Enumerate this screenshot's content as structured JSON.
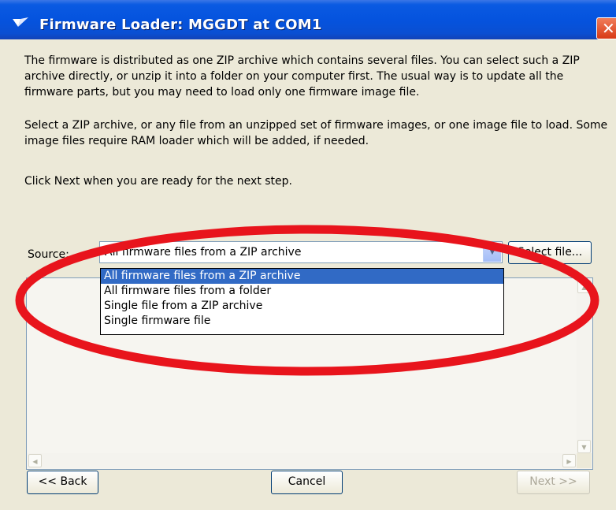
{
  "window": {
    "title": "Firmware Loader:  MGGDT at COM1",
    "close_glyph": "✕"
  },
  "body": {
    "paragraph1": "The firmware is distributed as one ZIP archive which contains several files. You can select such a ZIP archive directly, or unzip it into a folder on your computer first. The usual way is to update all the firmware parts, but you may need to load only one firmware image file.",
    "paragraph2": "Select a ZIP archive, or any file from an unzipped set of firmware images, or one image file to load. Some image files require RAM loader which will be added, if needed.",
    "paragraph3": "Click Next when you are ready for the next step."
  },
  "source": {
    "label": "Source:",
    "selected": "All firmware files from a ZIP archive",
    "select_file_label": "Select file...",
    "options": [
      "All firmware files from a ZIP archive",
      "All firmware files from a folder",
      "Single file from a ZIP archive",
      "Single firmware file"
    ],
    "highlighted_index": 0
  },
  "buttons": {
    "back": "<< Back",
    "cancel": "Cancel",
    "next": "Next >>"
  },
  "colors": {
    "annotation_ellipse": "#e8141c",
    "selection": "#316ac5"
  }
}
